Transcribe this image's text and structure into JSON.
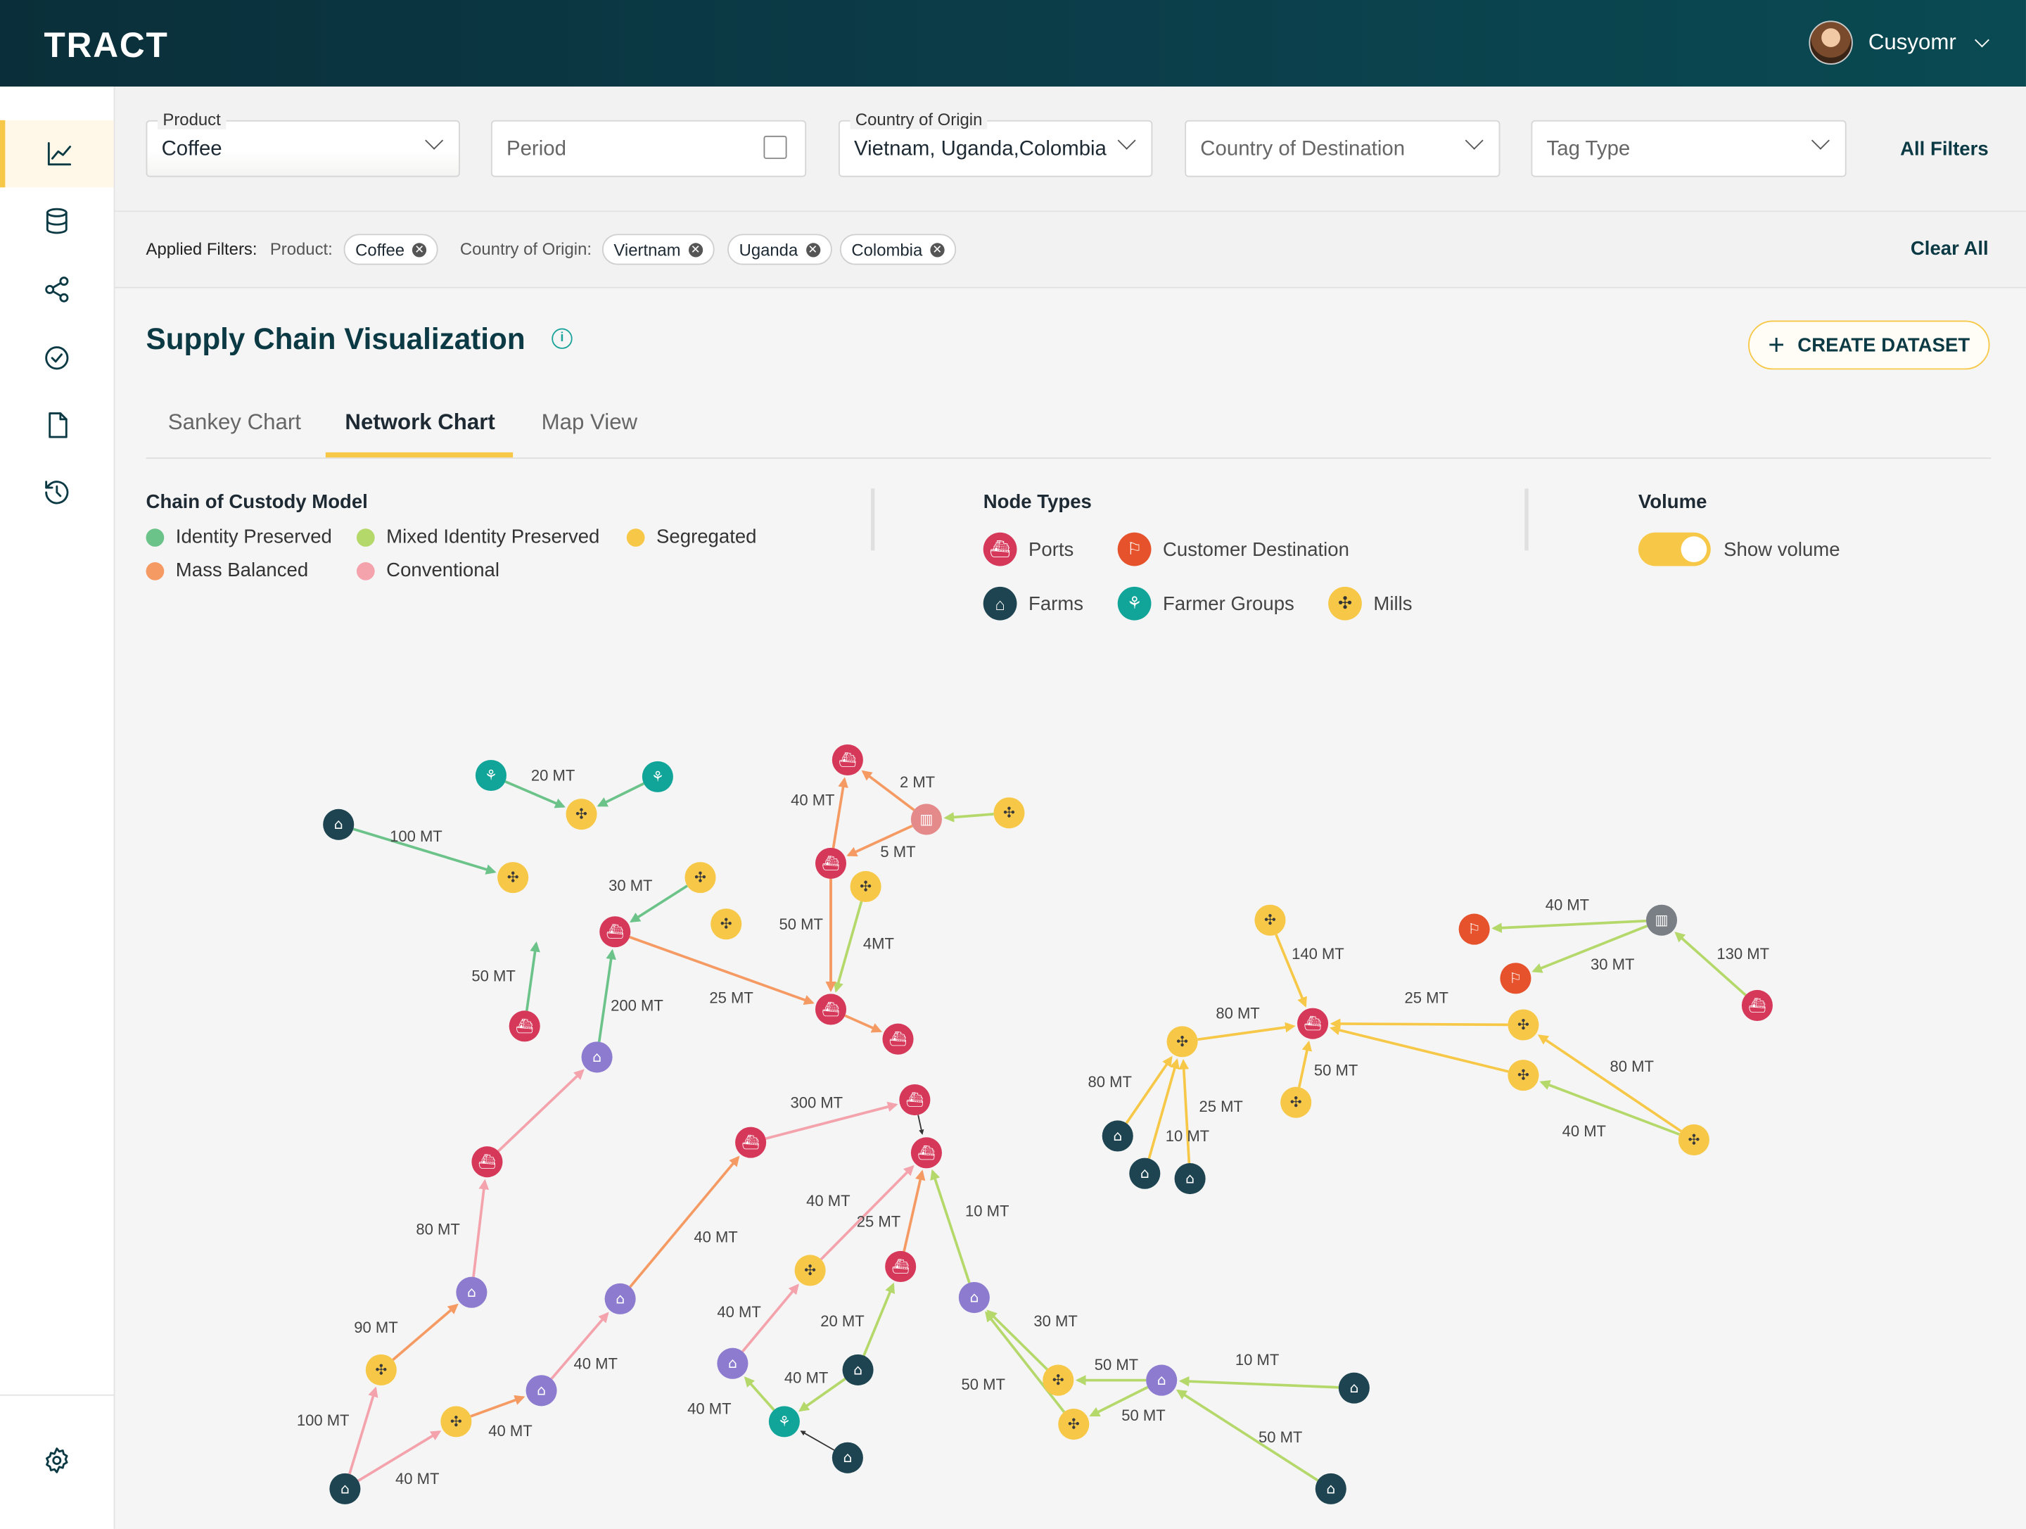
{
  "app": {
    "logo": "TRACT",
    "user_name": "Cusyomr"
  },
  "sidebar": {
    "items": [
      "analytics-icon",
      "database-icon",
      "share-icon",
      "check-circle-icon",
      "document-icon",
      "history-icon"
    ],
    "bottom": "settings-icon"
  },
  "filters": {
    "product": {
      "label": "Product",
      "value": "Coffee"
    },
    "period": {
      "placeholder": "Period"
    },
    "origin": {
      "label": "Country of Origin",
      "value": "Vietnam, Uganda,Colombia"
    },
    "destination": {
      "placeholder": "Country of Destination"
    },
    "tag_type": {
      "placeholder": "Tag Type"
    },
    "all_filters": "All Filters"
  },
  "applied": {
    "label": "Applied Filters:",
    "product_label": "Product:",
    "product_chips": [
      "Coffee"
    ],
    "origin_label": "Country of Origin:",
    "origin_chips": [
      "Viertnam",
      "Uganda",
      "Colombia"
    ],
    "clear_all": "Clear All"
  },
  "page": {
    "title": "Supply Chain Visualization",
    "create_label": "CREATE DATASET"
  },
  "tabs": [
    "Sankey Chart",
    "Network Chart",
    "Map View"
  ],
  "legend": {
    "custody_title": "Chain of Custody Model",
    "custody": [
      {
        "label": "Identity Preserved",
        "color": "#6cc38a"
      },
      {
        "label": "Mixed Identity Preserved",
        "color": "#b5d86a"
      },
      {
        "label": "Segregated",
        "color": "#f7c847"
      },
      {
        "label": "Mass Balanced",
        "color": "#f59a63"
      },
      {
        "label": "Conventional",
        "color": "#f4a3ad"
      }
    ],
    "node_title": "Node Types",
    "nodes": [
      {
        "label": "Ports",
        "color": "#d6385a",
        "icon": "ship-icon"
      },
      {
        "label": "Customer Destination",
        "color": "#e5522b",
        "icon": "destination-icon"
      },
      {
        "label": "Farms",
        "color": "#1d4450",
        "icon": "farm-icon"
      },
      {
        "label": "Farmer Groups",
        "color": "#11a59a",
        "icon": "farmer-group-icon"
      },
      {
        "label": "Mills",
        "color": "#f7c847",
        "icon": "mill-icon"
      }
    ],
    "volume_title": "Volume",
    "show_volume": "Show volume"
  },
  "network": {
    "colors": {
      "port": "#d6385a",
      "dest": "#e5522b",
      "farm": "#1d4450",
      "group": "#11a59a",
      "mill": "#f7c847",
      "facility": "#8c7bcf",
      "grey": "#7a7f86",
      "pink": "#e58a8a",
      "green": "#6cc38a",
      "lime": "#b5d86a",
      "yellow": "#f7c847",
      "orange": "#f59a63",
      "rose": "#f4a3ad",
      "dark": "#333333"
    },
    "edge_labels": [
      "20 MT",
      "100 MT",
      "40 MT",
      "2 MT",
      "5 MT",
      "30 MT",
      "50 MT",
      "4MT",
      "50 MT",
      "200 MT",
      "25 MT",
      "300 MT",
      "80 MT",
      "40 MT",
      "40 MT",
      "25 MT",
      "10 MT",
      "90 MT",
      "40 MT",
      "40 MT",
      "40 MT",
      "20 MT",
      "100 MT",
      "40 MT",
      "40 MT",
      "40 MT",
      "30 MT",
      "50 MT",
      "50 MT",
      "50 MT",
      "10 MT",
      "50 MT",
      "140 MT",
      "30 MT",
      "130 MT",
      "40 MT",
      "80 MT",
      "25 MT",
      "50 MT",
      "80 MT",
      "25 MT",
      "10 MT",
      "80 MT",
      "40 MT"
    ]
  }
}
